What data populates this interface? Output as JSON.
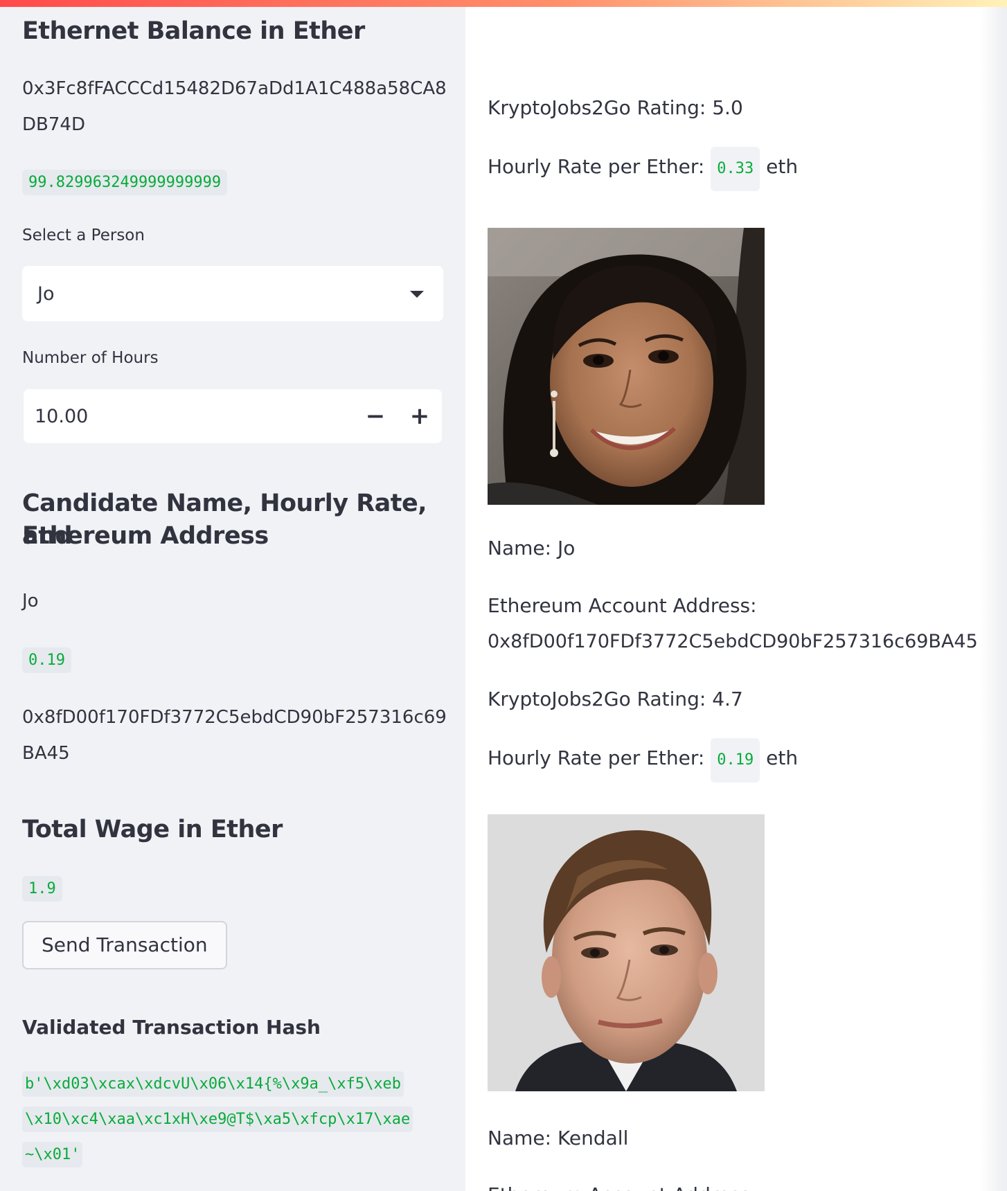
{
  "sidebar": {
    "balance_heading": "Ethernet Balance in Ether",
    "account_address_line1": "0x3Fc8fFACCCd15482D67aDd1A1C488a58CA8",
    "account_address_line2": "DB74D",
    "balance_value": "99.829963249999999999",
    "select_label": "Select a Person",
    "select_value": "Jo",
    "hours_label": "Number of Hours",
    "hours_value": "10.00",
    "minus_label": "−",
    "plus_label": "+",
    "candidate_heading_line1": "Candidate Name, Hourly Rate, and",
    "candidate_heading_line2": "Ethereum Address",
    "candidate_name": "Jo",
    "candidate_rate": "0.19",
    "candidate_address_line1": "0x8fD00f170FDf3772C5ebdCD90bF257316c69",
    "candidate_address_line2": "BA45",
    "wage_heading": "Total Wage in Ether",
    "wage_value": "1.9",
    "send_button": "Send Transaction",
    "hash_heading": "Validated Transaction Hash",
    "hash_line1": "b'\\xd03\\xcax\\xdcvU\\x06\\x14{%\\x9a_\\xf5\\xeb",
    "hash_line2": "\\x10\\xc4\\xaa\\xc1xH\\xe9@T$\\xa5\\xfcp\\x17\\xae",
    "hash_line3": "~\\x01'"
  },
  "main": {
    "candidates": [
      {
        "rating": "KryptoJobs2Go Rating: 5.0",
        "rate_prefix": "Hourly Rate per Ether:",
        "rate": "0.33",
        "rate_suffix": "eth"
      },
      {
        "name": "Name: Jo",
        "address_label": "Ethereum Account Address:",
        "address": "0x8fD00f170FDf3772C5ebdCD90bF257316c69BA45",
        "rating": "KryptoJobs2Go Rating: 4.7",
        "rate_prefix": "Hourly Rate per Ether:",
        "rate": "0.19",
        "rate_suffix": "eth"
      },
      {
        "name": "Name: Kendall",
        "address_label": "Ethereum Account Address:"
      }
    ]
  }
}
